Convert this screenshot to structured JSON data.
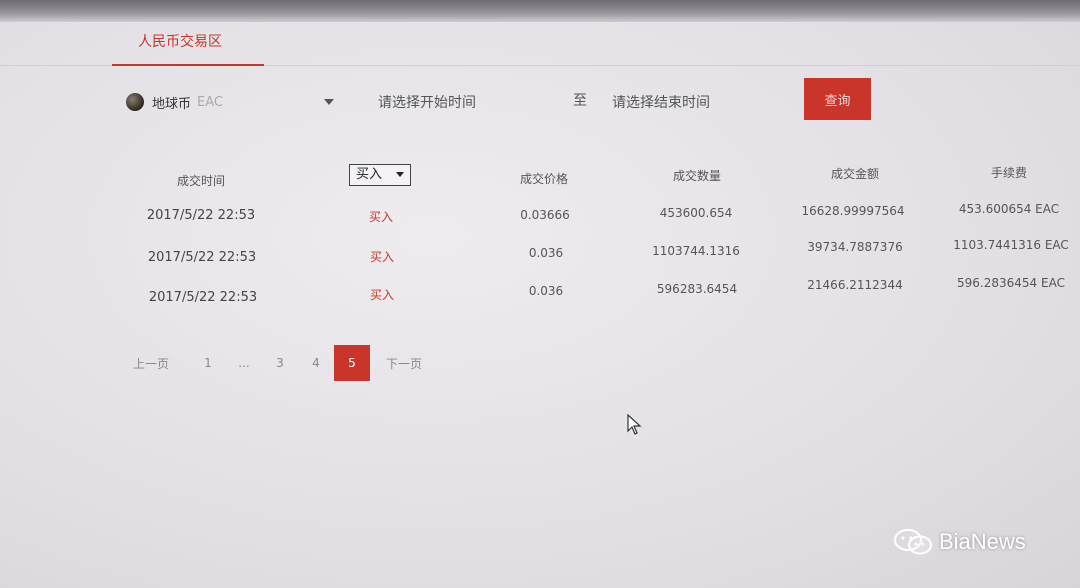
{
  "tabs": {
    "active_label": "人民币交易区"
  },
  "filters": {
    "coin_name": "地球币",
    "coin_code": "EAC",
    "start_placeholder": "请选择开始时间",
    "to_label": "至",
    "end_placeholder": "请选择结束时间",
    "query_label": "查询"
  },
  "table": {
    "headers": {
      "time": "成交时间",
      "type_select": "买入",
      "price": "成交价格",
      "quantity": "成交数量",
      "amount": "成交金额",
      "fee": "手续费"
    },
    "rows": [
      {
        "time": "2017/5/22 22:53",
        "type": "买入",
        "price": "0.03666",
        "quantity": "453600.654",
        "amount": "16628.99997564",
        "fee": "453.600654 EAC"
      },
      {
        "time": "2017/5/22 22:53",
        "type": "买入",
        "price": "0.036",
        "quantity": "1103744.1316",
        "amount": "39734.7887376",
        "fee": "1103.7441316 EAC"
      },
      {
        "time": "2017/5/22 22:53",
        "type": "买入",
        "price": "0.036",
        "quantity": "596283.6454",
        "amount": "21466.2112344",
        "fee": "596.2836454 EAC"
      }
    ]
  },
  "pagination": {
    "prev_label": "上一页",
    "pages": [
      "1",
      "...",
      "3",
      "4",
      "5"
    ],
    "current": "5",
    "next_label": "下一页"
  },
  "watermark": {
    "text": "BiaNews"
  },
  "colors": {
    "accent": "#c9342b"
  }
}
